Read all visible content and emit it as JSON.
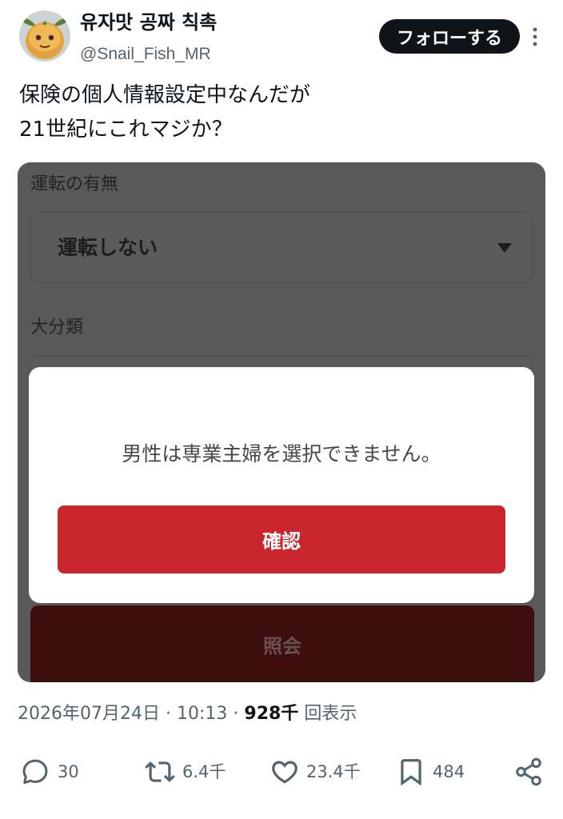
{
  "user": {
    "display_name": "유자맛 공짜 칙촉",
    "handle": "@Snail_Fish_MR",
    "avatar_icon": "avatar-yuzu-face"
  },
  "follow_button": {
    "label": "フォローする"
  },
  "more_icon": "more-vertical-icon",
  "tweet": {
    "lines": [
      "保険の個人情報設定中なんだが",
      "21世紀にこれマジか？"
    ]
  },
  "media": {
    "field1_label": "運転の有無",
    "field1_value": "運転しない",
    "field1_icon": "caret-down-icon",
    "field2_label": "大分類",
    "dialog": {
      "message": "男性は専業主婦を選択できません。",
      "confirm_label": "確認"
    },
    "submit_label": "照会"
  },
  "meta": {
    "date": "2026年07月24日",
    "separator": "·",
    "time": "10:13",
    "views_count": "928千",
    "views_label": "回表示"
  },
  "actions": {
    "replies": "30",
    "reposts": "6.4千",
    "likes": "23.4千",
    "bookmarks": "484",
    "icons": [
      "reply-icon",
      "repost-icon",
      "like-icon",
      "bookmark-icon",
      "share-icon"
    ]
  },
  "colors": {
    "text": "#0f1419",
    "muted": "#536471",
    "overlay": "#595959",
    "dialog_button": "#c8262c",
    "submit_button": "#3d0f0f"
  }
}
